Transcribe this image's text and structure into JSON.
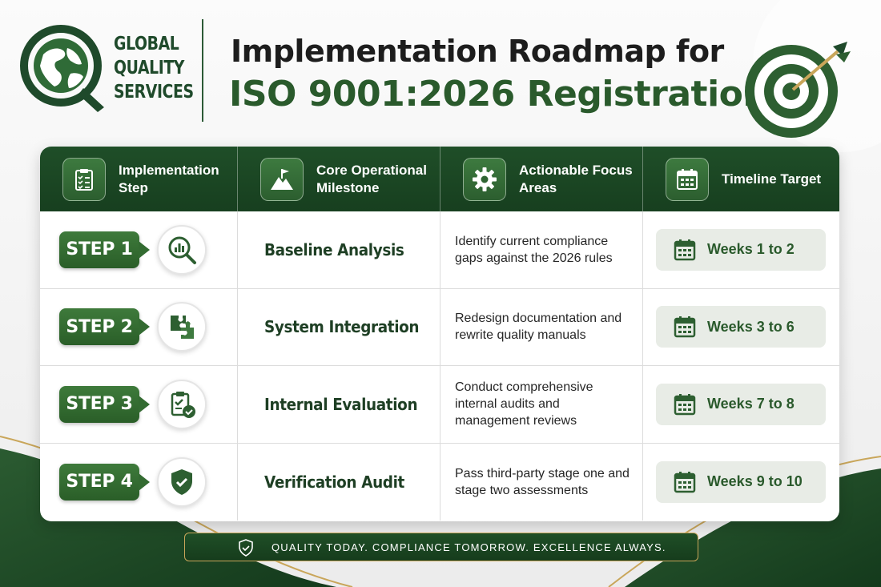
{
  "brand": {
    "lines": [
      "GLOBAL",
      "QUALITY",
      "SERVICES"
    ],
    "color": "#1f4a2b"
  },
  "title": {
    "line1": "Implementation Roadmap for",
    "line2": "ISO 9001:2026 Registration"
  },
  "table": {
    "headers": [
      {
        "label": "Implementation Step",
        "icon": "clipboard-checklist-icon"
      },
      {
        "label": "Core Operational Milestone",
        "icon": "mountain-flag-icon"
      },
      {
        "label": "Actionable Focus Areas",
        "icon": "gear-icon"
      },
      {
        "label": "Timeline Target",
        "icon": "calendar-icon"
      }
    ],
    "rows": [
      {
        "step": "STEP 1",
        "step_icon": "magnifier-chart-icon",
        "milestone": "Baseline Analysis",
        "focus": "Identify current compliance gaps against the 2026 rules",
        "timeline": "Weeks 1 to 2"
      },
      {
        "step": "STEP 2",
        "step_icon": "puzzle-icon",
        "milestone": "System Integration",
        "focus": "Redesign documentation and rewrite quality manuals",
        "timeline": "Weeks 3 to 6"
      },
      {
        "step": "STEP 3",
        "step_icon": "clipboard-check-icon",
        "milestone": "Internal Evaluation",
        "focus": "Conduct comprehensive internal audits and management reviews",
        "timeline": "Weeks 7 to 8"
      },
      {
        "step": "STEP 4",
        "step_icon": "shield-check-icon",
        "milestone": "Verification Audit",
        "focus": "Pass third-party stage one and stage two assessments",
        "timeline": "Weeks 9 to 10"
      }
    ]
  },
  "footer": {
    "tagline": "QUALITY TODAY. COMPLIANCE TOMORROW. EXCELLENCE ALWAYS.",
    "icon": "shield-check-icon"
  },
  "colors": {
    "primary_green": "#1f4e28",
    "accent_green": "#2a5a2c",
    "gold": "#c9a65a"
  }
}
